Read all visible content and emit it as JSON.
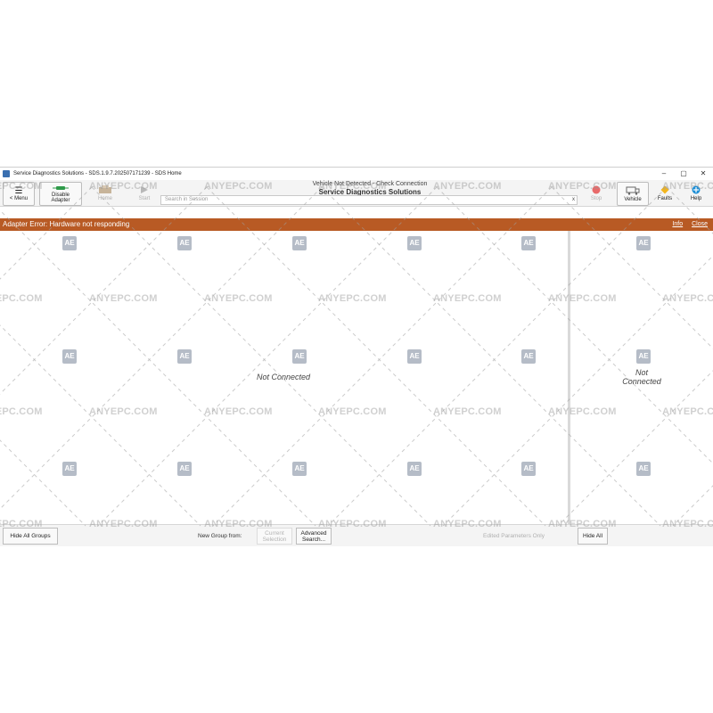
{
  "window": {
    "title": "Service Diagnostics Solutions - SDS.1.9.7.202507171239 - SDS Home",
    "controls": [
      "–",
      "▢",
      "✕"
    ]
  },
  "toolbar": {
    "menu_label": "< Menu",
    "disable_adapter_label": "Disable Adapter",
    "home_label": "Home",
    "start_label": "Start",
    "status_line": "Vehicle Not Detected - Check Connection",
    "app_name": "Service Diagnostics Solutions",
    "search_placeholder": "Search in Session",
    "search_clear": "x",
    "stop_label": "Stop",
    "vehicle_label": "Vehicle",
    "faults_label": "Faults",
    "help_label": "Help"
  },
  "error_bar": {
    "message": "Adapter Error: Hardware not responding",
    "info_link": "Info",
    "close_link": "Close"
  },
  "main": {
    "left_status": "Not Connected",
    "right_status_line1": "Not",
    "right_status_line2": "Connected"
  },
  "bottom_bar": {
    "hide_all_groups": "Hide All Groups",
    "new_group_from": "New Group from:",
    "current_selection": "Current Selection",
    "advanced_search": "Advanced Search...",
    "edited_params_only": "Edited Parameters Only",
    "hide_all": "Hide All"
  },
  "watermark": {
    "text": "ANYEPC.COM",
    "logo": "AE"
  },
  "colors": {
    "error_bar": "#b85a24",
    "toolbar_bg": "#f4f4f4",
    "adapter_icon": "#2e9a4a",
    "stop_icon": "#e86a6a",
    "faults_icon": "#f2b51e",
    "help_icon": "#1f8fd6"
  }
}
